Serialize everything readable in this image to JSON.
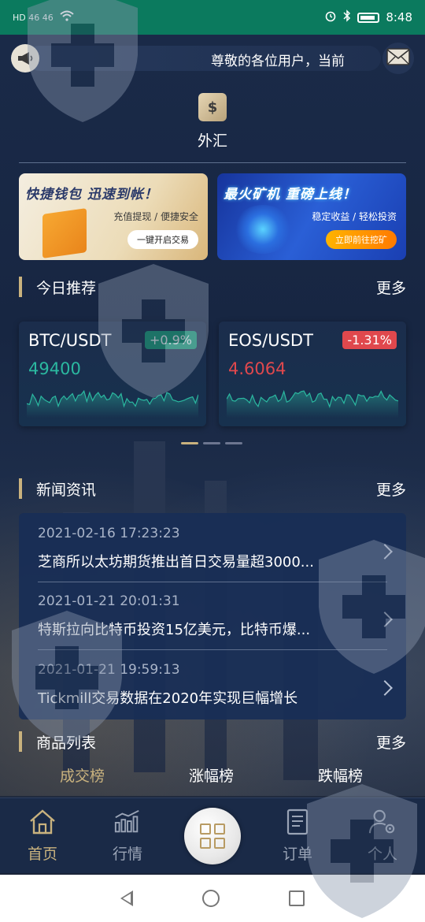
{
  "status_bar": {
    "left_small": "HD  46  46",
    "time": "8:48"
  },
  "notice": {
    "text": "尊敬的各位用户，当前"
  },
  "forex": {
    "label": "外汇"
  },
  "banners": [
    {
      "title": "快捷钱包  迅速到帐！",
      "subtitle": "充值提现 / 便捷安全",
      "button": "一键开启交易"
    },
    {
      "title": "最火矿机  重磅上线！",
      "subtitle": "稳定收益 / 轻松投资",
      "button": "立即前往挖矿"
    }
  ],
  "recommend": {
    "title": "今日推荐",
    "more": "更多",
    "cards": [
      {
        "pair": "BTC/USDT",
        "change": "+0.9%",
        "price": "49400",
        "trend": "up",
        "color": "#2bb8a0"
      },
      {
        "pair": "EOS/USDT",
        "change": "-1.31%",
        "price": "4.6064",
        "trend": "down",
        "color": "#2bb8a0"
      }
    ]
  },
  "news": {
    "title": "新闻资讯",
    "more": "更多",
    "items": [
      {
        "time": "2021-02-16 17:23:23",
        "title": "芝商所以太坊期货推出首日交易量超3000..."
      },
      {
        "time": "2021-01-21 20:01:31",
        "title": "特斯拉向比特币投资15亿美元，比特币爆..."
      },
      {
        "time": "2021-01-21 19:59:13",
        "title": "Tickmill交易数据在2020年实现巨幅增长"
      }
    ]
  },
  "products": {
    "title": "商品列表",
    "more": "更多",
    "tabs": [
      "成交榜",
      "涨幅榜",
      "跌幅榜"
    ]
  },
  "bottom_nav": {
    "items": [
      {
        "label": "首页",
        "icon": "home-icon",
        "active": true
      },
      {
        "label": "行情",
        "icon": "market-icon",
        "active": false
      },
      {
        "label": "订单",
        "icon": "order-icon",
        "active": false
      },
      {
        "label": "个人",
        "icon": "user-settings-icon",
        "active": false
      }
    ]
  },
  "colors": {
    "accent_gold": "#c9b27e",
    "up_green": "#1aa37a",
    "down_red": "#e0484d",
    "status_bar": "#0b7a5e"
  }
}
